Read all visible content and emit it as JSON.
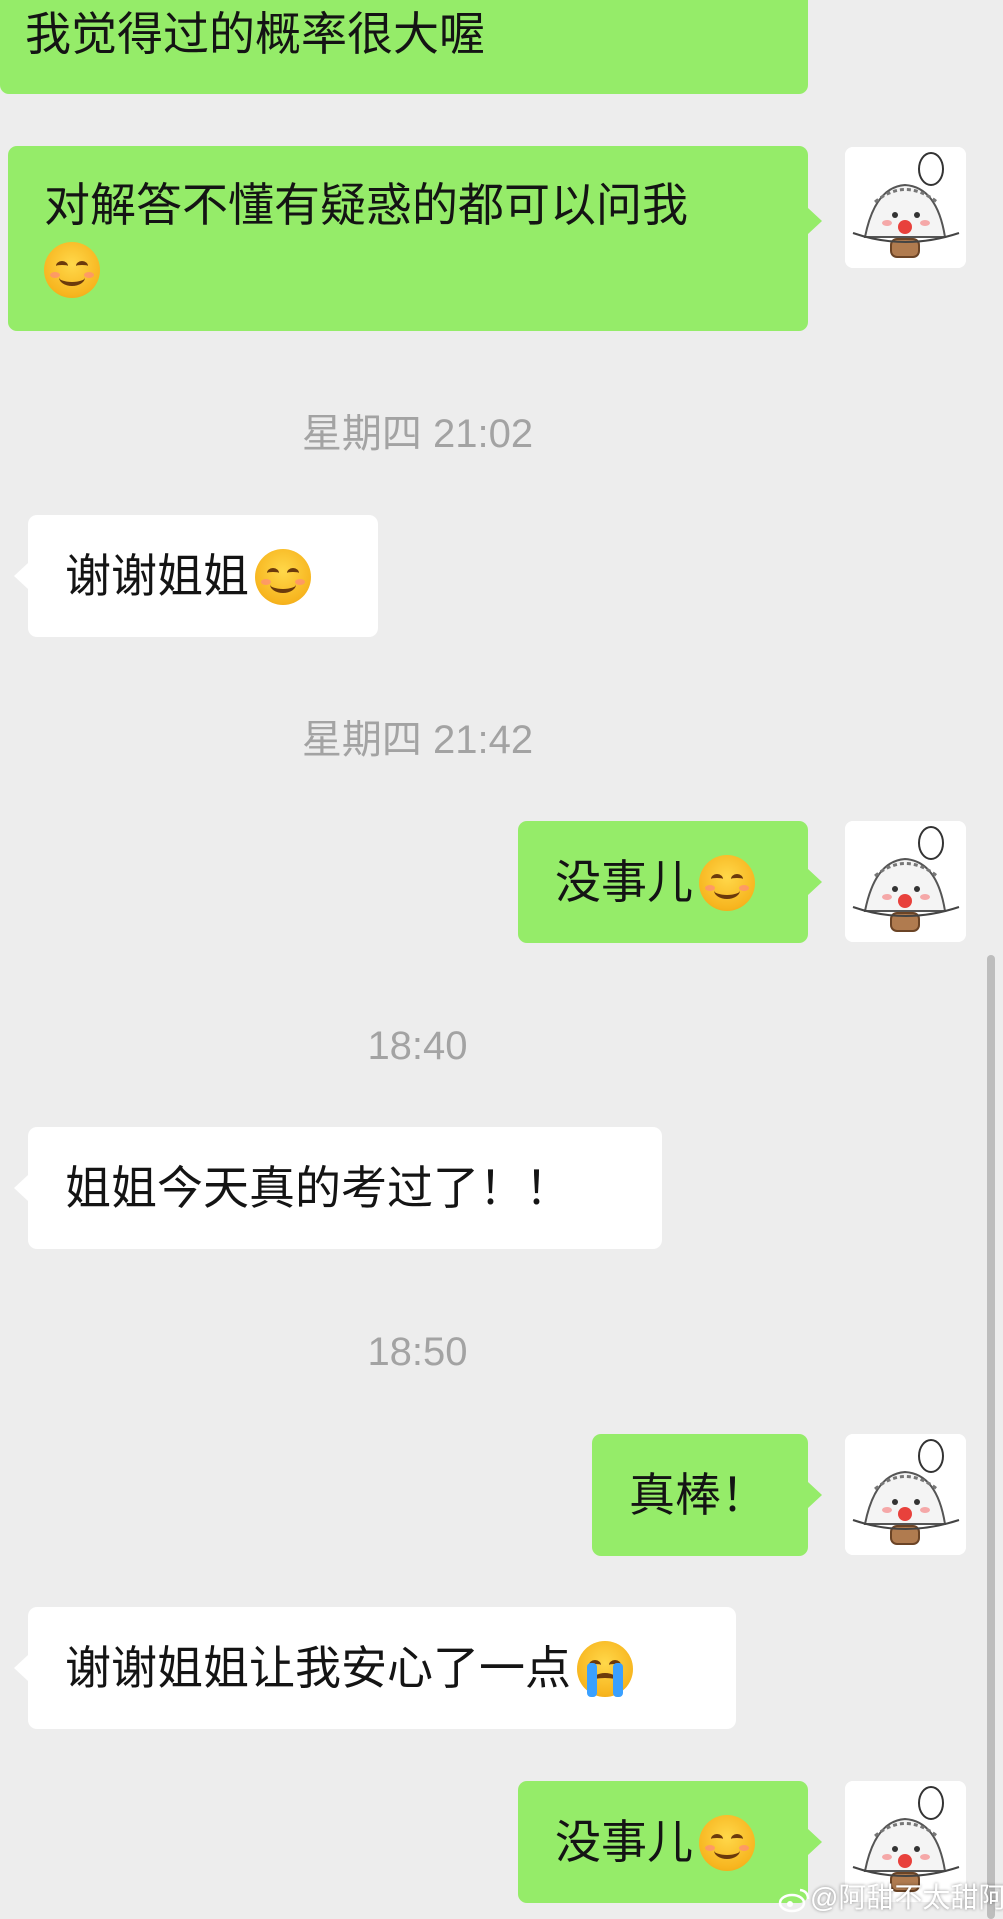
{
  "messages": [
    {
      "side": "self",
      "text": "我觉得过的概率很大喔",
      "emoji": ""
    },
    {
      "side": "self",
      "text": "对解答不懂有疑惑的都可以问我",
      "emoji": "smile-emoji"
    },
    {
      "timestamp": "星期四 21:02"
    },
    {
      "side": "other",
      "text": "谢谢姐姐",
      "emoji": "smile-emoji"
    },
    {
      "timestamp": "星期四 21:42"
    },
    {
      "side": "self",
      "text": "没事儿",
      "emoji": "smile-emoji"
    },
    {
      "timestamp": "18:40"
    },
    {
      "side": "other",
      "text": "姐姐今天真的考过了！！",
      "emoji": ""
    },
    {
      "timestamp": "18:50"
    },
    {
      "side": "self",
      "text": "真棒！",
      "emoji": ""
    },
    {
      "side": "other",
      "text": "谢谢姐姐让我安心了一点",
      "emoji": "crying-emoji"
    },
    {
      "side": "self",
      "text": "没事儿",
      "emoji": "smile-emoji"
    }
  ],
  "avatar": {
    "icon": "cartoon-avatar-icon"
  },
  "watermark": {
    "text": "@阿甜不太甜阿",
    "icon": "weibo-logo-icon"
  },
  "colors": {
    "self_bubble": "#95ec69",
    "other_bubble": "#ffffff",
    "background": "#ededed",
    "timestamp": "#a3a3a3"
  }
}
